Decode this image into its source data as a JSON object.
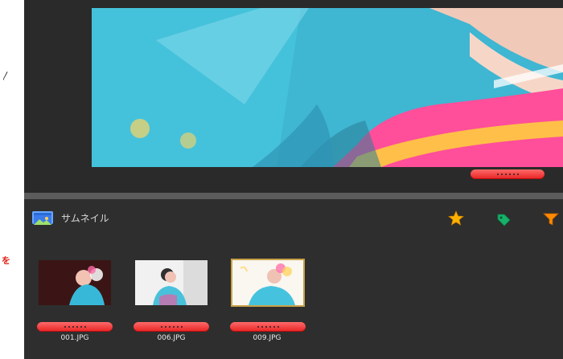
{
  "side_marks": {
    "top": "〳",
    "middle": "を"
  },
  "thumbnail_panel": {
    "title": "サムネイル"
  },
  "colors": {
    "background": "#2b2b2b",
    "rating_pill": "#e82222",
    "star": "#ffb300",
    "tag": "#17b26a",
    "filter": "#ff8a00",
    "selected_border": "#c8a24b"
  },
  "toolbar_icons": [
    "star-icon",
    "tag-icon",
    "filter-icon"
  ],
  "thumbnails": [
    {
      "label": "001.JPG",
      "selected": false
    },
    {
      "label": "006.JPG",
      "selected": false
    },
    {
      "label": "009.JPG",
      "selected": true
    }
  ]
}
